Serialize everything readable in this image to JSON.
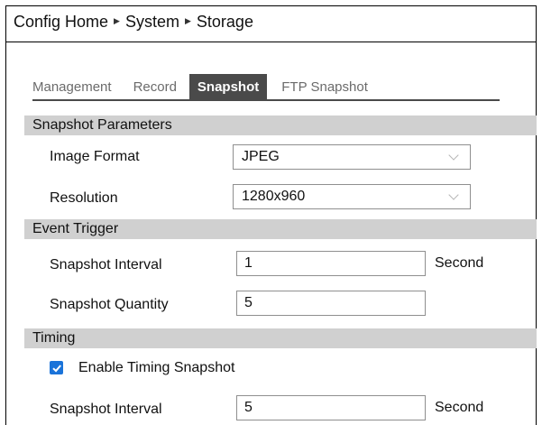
{
  "breadcrumb": {
    "items": [
      "Config Home",
      "System",
      "Storage"
    ],
    "separator": "▶"
  },
  "tabs": [
    {
      "label": "Management",
      "active": false
    },
    {
      "label": "Record",
      "active": false
    },
    {
      "label": "Snapshot",
      "active": true
    },
    {
      "label": "FTP Snapshot",
      "active": false
    }
  ],
  "sections": {
    "snapshot_parameters": {
      "title": "Snapshot Parameters",
      "image_format": {
        "label": "Image Format",
        "value": "JPEG"
      },
      "resolution": {
        "label": "Resolution",
        "value": "1280x960"
      }
    },
    "event_trigger": {
      "title": "Event Trigger",
      "interval": {
        "label": "Snapshot Interval",
        "value": "1",
        "unit": "Second"
      },
      "quantity": {
        "label": "Snapshot Quantity",
        "value": "5"
      }
    },
    "timing": {
      "title": "Timing",
      "enable": {
        "label": "Enable Timing Snapshot",
        "checked": true
      },
      "interval": {
        "label": "Snapshot Interval",
        "value": "5",
        "unit": "Second"
      }
    }
  },
  "colors": {
    "active_tab": "#4a4a4a",
    "section_bar": "#d0d0d0",
    "checkbox": "#1a73d9"
  },
  "icons": {
    "separator": "play-arrow-icon",
    "dropdown": "chevron-down-icon",
    "checkbox": "checkmark-icon"
  }
}
